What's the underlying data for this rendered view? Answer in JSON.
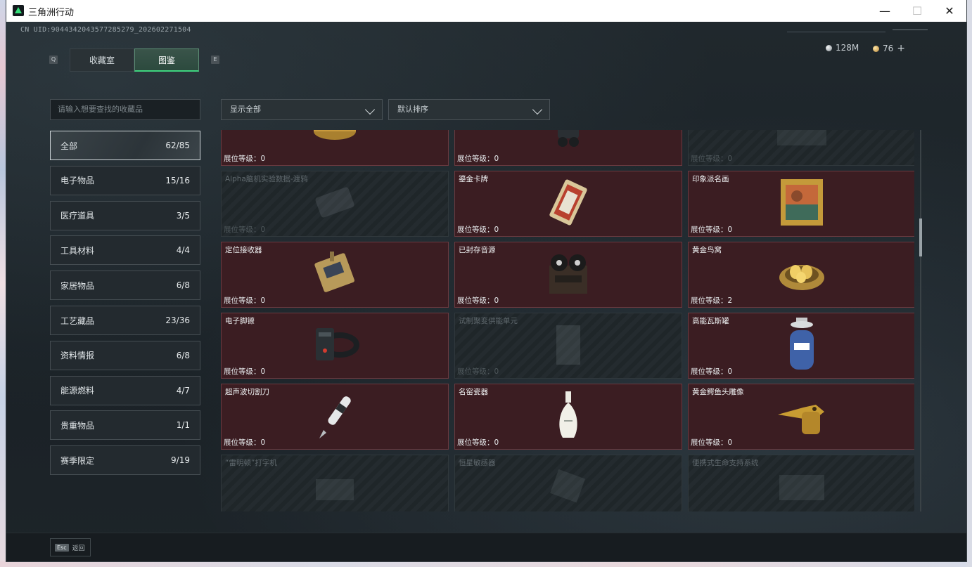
{
  "window": {
    "title": "三角洲行动",
    "minimize": "—",
    "maximize": "☐",
    "close": "✕"
  },
  "uid": "CN UID:9044342043577285279_202602271504",
  "tabs": {
    "left_key": "Q",
    "right_key": "E",
    "items": [
      {
        "label": "收藏室",
        "active": false
      },
      {
        "label": "图鉴",
        "active": true
      }
    ]
  },
  "currency": {
    "silver": "128M",
    "gold": "76",
    "add": "+"
  },
  "search": {
    "placeholder": "请输入想要查找的收藏品"
  },
  "filters": {
    "show": "显示全部",
    "sort": "默认排序"
  },
  "categories": [
    {
      "label": "全部",
      "count": "62/85",
      "active": true
    },
    {
      "label": "电子物品",
      "count": "15/16",
      "active": false
    },
    {
      "label": "医疗道具",
      "count": "3/5",
      "active": false
    },
    {
      "label": "工具材料",
      "count": "4/4",
      "active": false
    },
    {
      "label": "家居物品",
      "count": "6/8",
      "active": false
    },
    {
      "label": "工艺藏品",
      "count": "23/36",
      "active": false
    },
    {
      "label": "资料情报",
      "count": "6/8",
      "active": false
    },
    {
      "label": "能源燃料",
      "count": "4/7",
      "active": false
    },
    {
      "label": "贵重物品",
      "count": "1/1",
      "active": false
    },
    {
      "label": "赛季限定",
      "count": "9/19",
      "active": false
    }
  ],
  "level_label": "展位等级：",
  "items": [
    {
      "name": "",
      "level": "0",
      "owned": true,
      "icon": "gold-tin-icon"
    },
    {
      "name": "",
      "level": "0",
      "owned": true,
      "icon": "robot-device-icon"
    },
    {
      "name": "",
      "level": "0",
      "owned": false,
      "icon": "generic-box-icon"
    },
    {
      "name": "Alpha脑机实验数据-渡鸦",
      "level": "0",
      "owned": false,
      "icon": "data-drive-icon"
    },
    {
      "name": "鎏金卡牌",
      "level": "0",
      "owned": true,
      "icon": "gilded-card-icon"
    },
    {
      "name": "印象派名画",
      "level": "0",
      "owned": true,
      "icon": "framed-painting-icon"
    },
    {
      "name": "定位接收器",
      "level": "0",
      "owned": true,
      "icon": "gps-receiver-icon"
    },
    {
      "name": "已封存音源",
      "level": "0",
      "owned": true,
      "icon": "reel-recorder-icon"
    },
    {
      "name": "黄金鸟窝",
      "level": "2",
      "owned": true,
      "icon": "golden-nest-icon"
    },
    {
      "name": "电子脚镣",
      "level": "0",
      "owned": true,
      "icon": "ankle-monitor-icon"
    },
    {
      "name": "试制聚变供能单元",
      "level": "0",
      "owned": false,
      "icon": "fusion-cell-icon"
    },
    {
      "name": "高能瓦斯罐",
      "level": "0",
      "owned": true,
      "icon": "gas-canister-icon"
    },
    {
      "name": "超声波切割刀",
      "level": "0",
      "owned": true,
      "icon": "ultrasonic-knife-icon"
    },
    {
      "name": "名窑瓷器",
      "level": "0",
      "owned": true,
      "icon": "porcelain-vase-icon"
    },
    {
      "name": "黄金鳄鱼头雕像",
      "level": "0",
      "owned": true,
      "icon": "gold-crocodile-icon"
    },
    {
      "name": "“雷明顿”打字机",
      "level": "",
      "owned": false,
      "icon": "typewriter-icon"
    },
    {
      "name": "恒星敏感器",
      "level": "",
      "owned": false,
      "icon": "star-sensor-icon"
    },
    {
      "name": "便携式生命支持系统",
      "level": "",
      "owned": false,
      "icon": "life-support-icon"
    }
  ],
  "footer": {
    "esc_key": "Esc",
    "back": "返回"
  }
}
